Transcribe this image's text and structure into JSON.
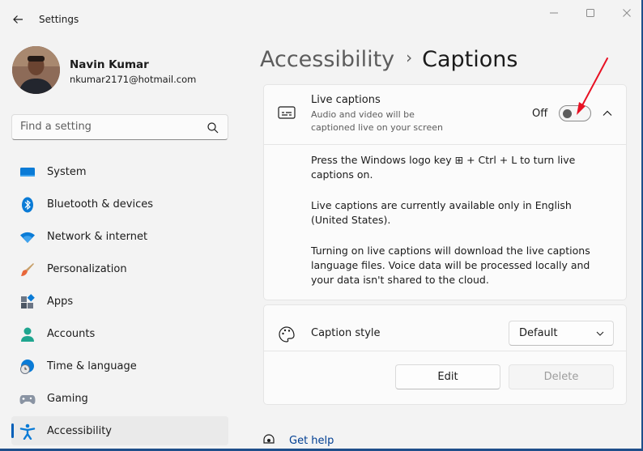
{
  "window": {
    "title": "Settings"
  },
  "profile": {
    "name": "Navin Kumar",
    "email": "nkumar2171@hotmail.com"
  },
  "search": {
    "placeholder": "Find a setting"
  },
  "nav": {
    "items": [
      {
        "label": "System",
        "icon": "system-icon"
      },
      {
        "label": "Bluetooth & devices",
        "icon": "bluetooth-icon"
      },
      {
        "label": "Network & internet",
        "icon": "wifi-icon"
      },
      {
        "label": "Personalization",
        "icon": "brush-icon"
      },
      {
        "label": "Apps",
        "icon": "apps-icon"
      },
      {
        "label": "Accounts",
        "icon": "person-icon"
      },
      {
        "label": "Time & language",
        "icon": "globe-clock-icon"
      },
      {
        "label": "Gaming",
        "icon": "gamepad-icon"
      },
      {
        "label": "Accessibility",
        "icon": "accessibility-icon",
        "active": true
      }
    ]
  },
  "header": {
    "parent": "Accessibility",
    "current": "Captions"
  },
  "live_captions": {
    "title": "Live captions",
    "description": "Audio and video will be captioned live on your screen",
    "toggle_state": "Off",
    "body": {
      "p1": "Press the Windows logo key ⊞ + Ctrl + L to turn live captions on.",
      "p2": "Live captions are currently available only in English (United States).",
      "p3": "Turning on live captions will download the live captions language files. Voice data will be processed locally and your data isn't shared to the cloud."
    }
  },
  "caption_style": {
    "title": "Caption style",
    "selected": "Default",
    "edit_label": "Edit",
    "delete_label": "Delete"
  },
  "help": {
    "label": "Get help"
  },
  "colors": {
    "accent": "#005fb8",
    "annotation": "#e81123"
  }
}
